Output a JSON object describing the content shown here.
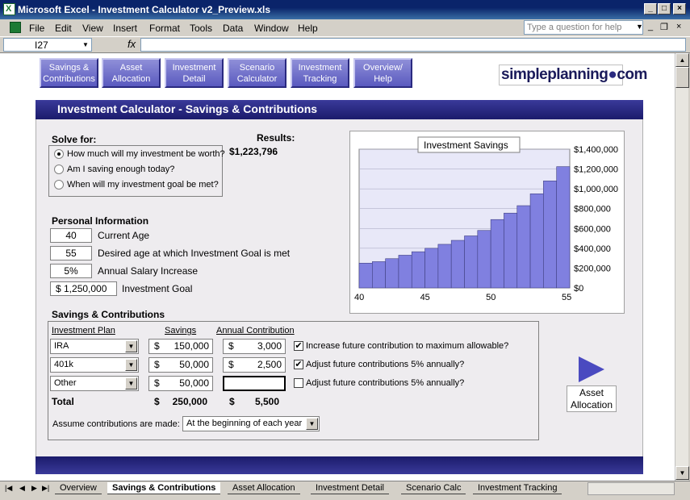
{
  "window": {
    "title": "Microsoft Excel - Investment Calculator v2_Preview.xls"
  },
  "menu": [
    "File",
    "Edit",
    "View",
    "Insert",
    "Format",
    "Tools",
    "Data",
    "Window",
    "Help"
  ],
  "help_placeholder": "Type a question for help",
  "namebox": "I27",
  "fx": "fx",
  "nav": [
    "Savings & Contributions",
    "Asset Allocation",
    "Investment Detail",
    "Scenario Calculator",
    "Investment Tracking",
    "Overview/ Help"
  ],
  "logo": {
    "text1": "simpleplanning",
    "text2": "com"
  },
  "banner": "Investment Calculator - Savings & Contributions",
  "solve": {
    "title": "Solve for:",
    "options": [
      "How much will my investment be worth?",
      "Am I saving enough today?",
      "When will my investment goal be met?"
    ],
    "selected": 0
  },
  "results": {
    "title": "Results:",
    "value": "$1,223,796"
  },
  "personal": {
    "title": "Personal Information",
    "rows": [
      {
        "value": "40",
        "label": "Current Age"
      },
      {
        "value": "55",
        "label": "Desired age at which Investment Goal is met"
      },
      {
        "value": "5%",
        "label": "Annual Salary Increase"
      },
      {
        "value": "$  1,250,000",
        "label": "Investment Goal"
      }
    ]
  },
  "savings": {
    "title": "Savings & Contributions",
    "headers": {
      "plan": "Investment Plan",
      "savings": "Savings",
      "contrib": "Annual Contribution"
    },
    "rows": [
      {
        "plan": "IRA",
        "cur1": "$",
        "savings": "150,000",
        "cur2": "$",
        "contrib": "3,000",
        "checked": true,
        "option": "Increase future contribution to maximum allowable?"
      },
      {
        "plan": "401k",
        "cur1": "$",
        "savings": "50,000",
        "cur2": "$",
        "contrib": "2,500",
        "checked": true,
        "option": "Adjust future contributions 5% annually?"
      },
      {
        "plan": "Other",
        "cur1": "$",
        "savings": "50,000",
        "cur2": "",
        "contrib": "",
        "checked": false,
        "option": "Adjust future contributions 5% annually?"
      }
    ],
    "total": {
      "label": "Total",
      "cur1": "$",
      "savings": "250,000",
      "cur2": "$",
      "contrib": "5,500"
    },
    "assume_label": "Assume contributions are made:",
    "assume_value": "At the beginning of each year"
  },
  "next": {
    "label": "Asset Allocation"
  },
  "tabs": [
    "Overview",
    "Savings & Contributions",
    "Asset Allocation",
    "Investment Detail",
    "Scenario Calc",
    "Investment Tracking"
  ],
  "active_tab": 1,
  "chart_data": {
    "type": "bar",
    "title": "Investment Savings",
    "x": [
      40,
      41,
      42,
      43,
      44,
      45,
      46,
      47,
      48,
      49,
      50,
      51,
      52,
      53,
      54,
      55
    ],
    "x_ticks": [
      40,
      45,
      50,
      55
    ],
    "values": [
      250000,
      265000,
      295000,
      330000,
      365000,
      400000,
      440000,
      480000,
      525000,
      580000,
      690000,
      755000,
      830000,
      950000,
      1080000,
      1223796
    ],
    "ylim": [
      0,
      1400000
    ],
    "y_ticks": [
      "$0",
      "$200,000",
      "$400,000",
      "$600,000",
      "$800,000",
      "$1,000,000",
      "$1,200,000",
      "$1,400,000"
    ],
    "bar_color": "#8080e0",
    "background": "#e8e8f8",
    "axis_side": "right"
  }
}
